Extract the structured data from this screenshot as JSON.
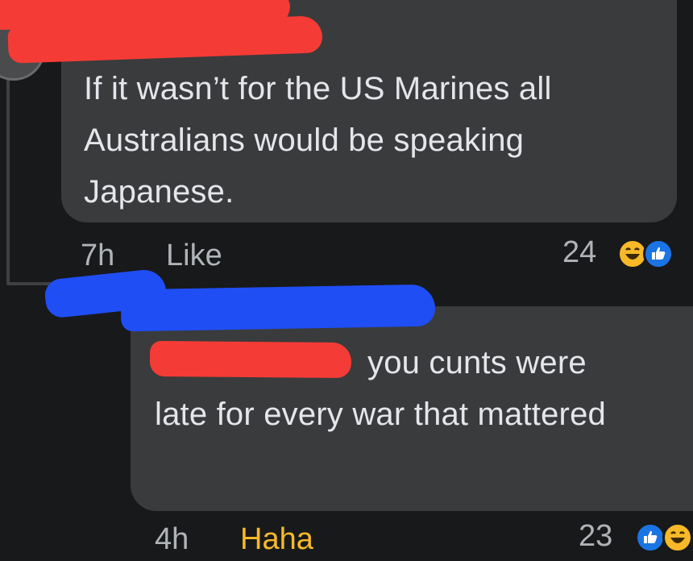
{
  "comment": {
    "text": "If it wasn’t for the US Marines all Australians would be speaking Japanese.",
    "time": "7h",
    "like_label": "Like",
    "reaction_count": "24",
    "reactions": [
      "haha-icon",
      "like-icon"
    ]
  },
  "reply": {
    "text_first_line": "you cunts were",
    "text_rest": "late for every war that mattered",
    "time": "4h",
    "reaction_label": "Haha",
    "reaction_count": "23",
    "reactions": [
      "like-icon",
      "haha-icon"
    ]
  },
  "colors": {
    "background": "#18191a",
    "bubble": "#3a3b3c",
    "text": "#e4e6eb",
    "meta_text": "#b0b3b8",
    "haha": "#f7b928",
    "like": "#1b74e4",
    "redaction_red": "#f53b35",
    "redaction_blue": "#1f4ef5"
  }
}
